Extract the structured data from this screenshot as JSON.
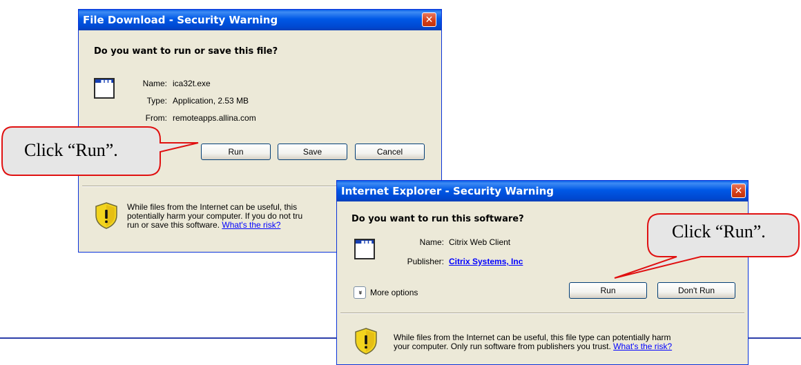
{
  "file_download_dialog": {
    "title": "File Download - Security Warning",
    "close_label": "✕",
    "question": "Do you want to run or save this file?",
    "name_label": "Name:",
    "name_value": "ica32t.exe",
    "type_label": "Type:",
    "type_value": "Application, 2.53 MB",
    "from_label": "From:",
    "from_value": "remoteapps.allina.com",
    "run_label": "Run",
    "save_label": "Save",
    "cancel_label": "Cancel",
    "warning_line1": "While files from the Internet can be useful, this",
    "warning_line2": "potentially harm your computer. If you do not tru",
    "warning_line3": "run or save this software. ",
    "risk_link": "What's the risk?"
  },
  "ie_dialog": {
    "title": "Internet Explorer - Security Warning",
    "close_label": "✕",
    "question": "Do you want to run this software?",
    "name_label": "Name:",
    "name_value": "Citrix Web Client",
    "publisher_label": "Publisher:",
    "publisher_value": "Citrix Systems, Inc",
    "more_options_icon": "»",
    "more_options_label": "More options",
    "run_label": "Run",
    "dont_run_label": "Don't Run",
    "warning_line1": "While files from the Internet can be useful, this file type can potentially harm",
    "warning_line2": "your computer. Only run software from publishers you trust. ",
    "risk_link": "What's the risk?"
  },
  "callouts": {
    "left": "Click “Run”.",
    "right": "Click “Run”."
  },
  "icons": [
    "app-window-icon",
    "shield-warning-icon",
    "close-icon",
    "chevron-double-down-icon"
  ],
  "colors": {
    "titlebar": "#0058e6",
    "dialog_bg": "#ece9d8",
    "callout_border": "#e01010",
    "callout_fill": "#e6e6e6",
    "rule": "#2b3da8"
  }
}
